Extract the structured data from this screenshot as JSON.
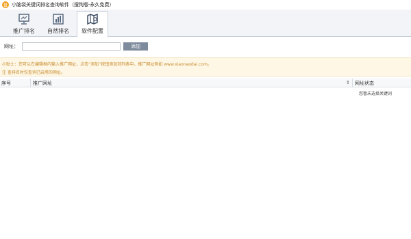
{
  "window": {
    "logo_text": "鼠",
    "title": "小脑袋关键词排名查询软件（搜狗版-永久免费）"
  },
  "tabs": [
    {
      "label": "推广排名",
      "icon": "monitor-chart-icon",
      "active": false
    },
    {
      "label": "自然排名",
      "icon": "bar-chart-icon",
      "active": false
    },
    {
      "label": "软件配置",
      "icon": "map-config-icon",
      "active": true
    }
  ],
  "url_form": {
    "label": "网址：",
    "value": "",
    "placeholder": "",
    "add_button": "添加"
  },
  "tips": {
    "line1": "小贴士：您可以在编辑框内输入推广网址，点击“添加”按钮添加到列表中，推广网址例如 www.xiaonaodai.com。",
    "line2": "注 查排名时仅查询已启用的网址。"
  },
  "table": {
    "columns": [
      "序号",
      "推广网址",
      "网址状态"
    ],
    "empty_message": "您暂未选择关键词"
  }
}
